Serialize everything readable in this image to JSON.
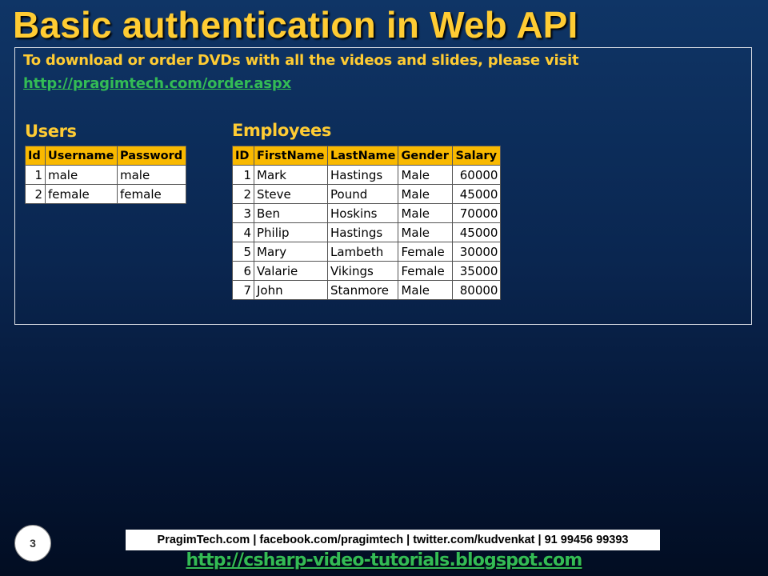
{
  "slide": {
    "title": "Basic authentication in Web API",
    "intro_text": "To download or order DVDs with all the videos and slides, please visit",
    "order_link": "http://pragimtech.com/order.aspx",
    "page_number": "3"
  },
  "users": {
    "title": "Users",
    "columns": [
      "Id",
      "Username",
      "Password"
    ],
    "rows": [
      [
        "1",
        "male",
        "male"
      ],
      [
        "2",
        "female",
        "female"
      ]
    ]
  },
  "employees": {
    "title": "Employees",
    "columns": [
      "ID",
      "FirstName",
      "LastName",
      "Gender",
      "Salary"
    ],
    "rows": [
      [
        "1",
        "Mark",
        "Hastings",
        "Male",
        "60000"
      ],
      [
        "2",
        "Steve",
        "Pound",
        "Male",
        "45000"
      ],
      [
        "3",
        "Ben",
        "Hoskins",
        "Male",
        "70000"
      ],
      [
        "4",
        "Philip",
        "Hastings",
        "Male",
        "45000"
      ],
      [
        "5",
        "Mary",
        "Lambeth",
        "Female",
        "30000"
      ],
      [
        "6",
        "Valarie",
        "Vikings",
        "Female",
        "35000"
      ],
      [
        "7",
        "John",
        "Stanmore",
        "Male",
        "80000"
      ]
    ]
  },
  "footer": {
    "contact": "PragimTech.com | facebook.com/pragimtech  | twitter.com/kudvenkat  | 91 99456 99393",
    "blog_link": "http://csharp-video-tutorials.blogspot.com"
  }
}
